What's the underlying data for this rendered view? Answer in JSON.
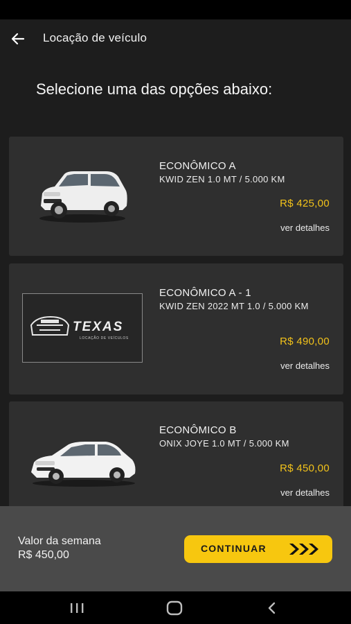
{
  "header": {
    "title": "Locação de veículo",
    "back_icon": "arrow-left-icon"
  },
  "heading": "Selecione uma das opções abaixo:",
  "vehicles": [
    {
      "category": "ECONÔMICO A",
      "model": "KWID ZEN 1.0 MT / 5.000 KM",
      "price": "R$ 425,00",
      "details_label": "ver detalhes",
      "image": "white-kwid-car"
    },
    {
      "category": "ECONÔMICO A - 1",
      "model": "KWID ZEN 2022 MT 1.0 / 5.000 KM",
      "price": "R$ 490,00",
      "details_label": "ver detalhes",
      "image": "texas-logo-placeholder",
      "logo_text": "TEXAS",
      "logo_subtext": "LOCAÇÃO DE VEÍCULOS"
    },
    {
      "category": "ECONÔMICO B",
      "model": "ONIX JOYE 1.0 MT / 5.000 KM",
      "price": "R$ 450,00",
      "details_label": "ver detalhes",
      "image": "white-onix-car"
    }
  ],
  "footer": {
    "total_label": "Valor da semana",
    "total_value": "R$ 450,00",
    "continue_label": "CONTINUAR",
    "continue_icon": "triple-chevron-right-icon"
  },
  "colors": {
    "background": "#1d1d1d",
    "card": "#2f2f2f",
    "price": "#f2c21a",
    "accent_button": "#f7c70f",
    "footer": "#4a4a4a"
  },
  "system_nav": {
    "recent_icon": "recent-apps-icon",
    "home_icon": "home-icon",
    "back_icon": "back-chevron-icon"
  }
}
